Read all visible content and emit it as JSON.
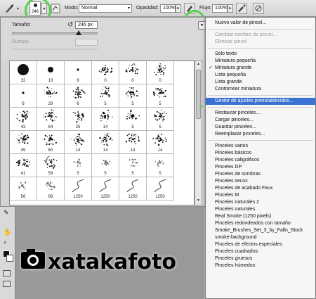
{
  "options_bar": {
    "mode_label": "Modo:",
    "mode_value": "Normal",
    "opacity_label": "Opacidad:",
    "opacity_value": "100%",
    "flow_label": "Flujo:",
    "flow_value": "100%",
    "brush_size": "246"
  },
  "brush_panel": {
    "size_label": "Tamaño:",
    "size_value": "246 px",
    "hardness_label": "Dureza:",
    "brushes": [
      {
        "label": "32",
        "kind": "round"
      },
      {
        "label": "13",
        "kind": "round"
      },
      {
        "label": "8",
        "kind": "dot"
      },
      {
        "label": "0",
        "kind": "spray"
      },
      {
        "label": "0",
        "kind": "spray"
      },
      {
        "label": "0",
        "kind": "spray"
      },
      {
        "label": "6",
        "kind": "dot"
      },
      {
        "label": "29",
        "kind": "spray"
      },
      {
        "label": "6",
        "kind": "spray"
      },
      {
        "label": "5",
        "kind": "spray"
      },
      {
        "label": "5",
        "kind": "spray"
      },
      {
        "label": "5",
        "kind": "spray"
      },
      {
        "label": "43",
        "kind": "spray"
      },
      {
        "label": "64",
        "kind": "spray"
      },
      {
        "label": "25",
        "kind": "spray"
      },
      {
        "label": "14",
        "kind": "spray"
      },
      {
        "label": "5",
        "kind": "spray"
      },
      {
        "label": "5",
        "kind": "spray"
      },
      {
        "label": "49",
        "kind": "spray"
      },
      {
        "label": "60",
        "kind": "spray"
      },
      {
        "label": "14",
        "kind": "spray"
      },
      {
        "label": "14",
        "kind": "spray"
      },
      {
        "label": "14",
        "kind": "spray"
      },
      {
        "label": "14",
        "kind": "spray"
      },
      {
        "label": "41",
        "kind": "spray"
      },
      {
        "label": "59",
        "kind": "spray"
      },
      {
        "label": "5",
        "kind": "star"
      },
      {
        "label": "5",
        "kind": "star"
      },
      {
        "label": "5",
        "kind": "star"
      },
      {
        "label": "5",
        "kind": "star"
      },
      {
        "label": "56",
        "kind": "star"
      },
      {
        "label": "68",
        "kind": "star"
      },
      {
        "label": "1250",
        "kind": "smoke"
      },
      {
        "label": "1250",
        "kind": "smoke"
      },
      {
        "label": "1250",
        "kind": "smoke"
      },
      {
        "label": "1250",
        "kind": "smoke"
      }
    ]
  },
  "watermark": "xatakafoto",
  "menu": {
    "items": [
      {
        "label": "Nuevo valor de pincel...",
        "disabled": false,
        "checked": false
      },
      {
        "sep": true
      },
      {
        "label": "Cambiar nombre de pincel...",
        "disabled": true,
        "checked": false
      },
      {
        "label": "Eliminar pincel",
        "disabled": true,
        "checked": false
      },
      {
        "sep": true
      },
      {
        "label": "Sólo texto",
        "disabled": false,
        "checked": false
      },
      {
        "label": "Miniatura pequeña",
        "disabled": false,
        "checked": false
      },
      {
        "label": "Miniatura grande",
        "disabled": false,
        "checked": true
      },
      {
        "label": "Lista pequeña",
        "disabled": false,
        "checked": false
      },
      {
        "label": "Lista grande",
        "disabled": false,
        "checked": false
      },
      {
        "label": "Contornear miniatura",
        "disabled": false,
        "checked": false
      },
      {
        "sep": true
      },
      {
        "label": "Gestor de ajustes preestablecidos...",
        "disabled": false,
        "checked": false,
        "highlight": true
      },
      {
        "sep": true
      },
      {
        "label": "Restaurar pinceles...",
        "disabled": false,
        "checked": false
      },
      {
        "label": "Cargar pinceles...",
        "disabled": false,
        "checked": false
      },
      {
        "label": "Guardar pinceles...",
        "disabled": false,
        "checked": false
      },
      {
        "label": "Reemplazar pinceles...",
        "disabled": false,
        "checked": false
      },
      {
        "sep": true
      },
      {
        "label": "Pinceles varios",
        "disabled": false,
        "checked": false
      },
      {
        "label": "Pinceles básicos",
        "disabled": false,
        "checked": false
      },
      {
        "label": "Pinceles caligráficos",
        "disabled": false,
        "checked": false
      },
      {
        "label": "Pinceles DP",
        "disabled": false,
        "checked": false
      },
      {
        "label": "Pinceles de sombras",
        "disabled": false,
        "checked": false
      },
      {
        "label": "Pinceles secos",
        "disabled": false,
        "checked": false
      },
      {
        "label": "Pinceles de acabado Faux",
        "disabled": false,
        "checked": false
      },
      {
        "label": "Pinceles M",
        "disabled": false,
        "checked": false
      },
      {
        "label": "Pinceles naturales 2",
        "disabled": false,
        "checked": false
      },
      {
        "label": "Pinceles naturales",
        "disabled": false,
        "checked": false
      },
      {
        "label": "Real Smoke (1250 pixels)",
        "disabled": false,
        "checked": false
      },
      {
        "label": "Pinceles redondeados con tamaño",
        "disabled": false,
        "checked": false
      },
      {
        "label": "Smoke_Brushes_Set_3_by_Falln_Stock",
        "disabled": false,
        "checked": false
      },
      {
        "label": "smoke-background",
        "disabled": false,
        "checked": false
      },
      {
        "label": "Pinceles de efectos especiales",
        "disabled": false,
        "checked": false
      },
      {
        "label": "Pinceles cuadrados",
        "disabled": false,
        "checked": false
      },
      {
        "label": "Pinceles gruesos",
        "disabled": false,
        "checked": false
      },
      {
        "label": "Pinceles húmedos",
        "disabled": false,
        "checked": false
      }
    ]
  },
  "colors": {
    "highlight": "#3a72d3",
    "annotation_green": "#58d04f"
  }
}
